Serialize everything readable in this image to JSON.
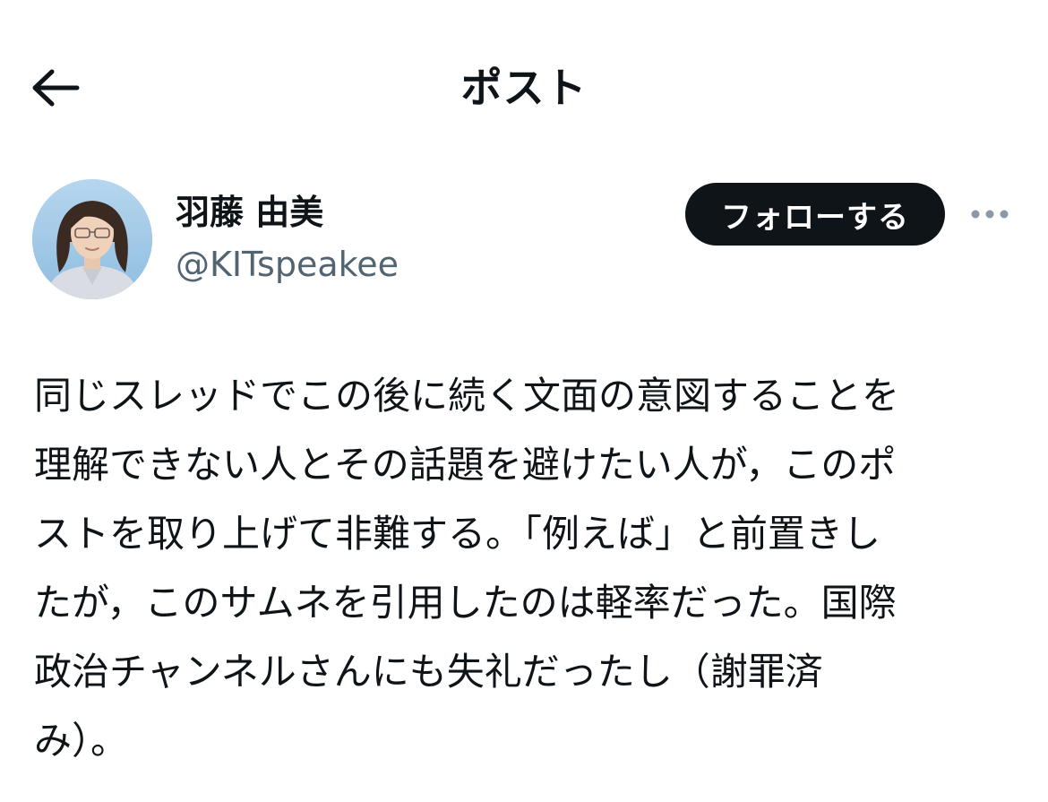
{
  "header": {
    "title": "ポスト",
    "back_icon": "arrow-left-icon"
  },
  "author": {
    "display_name": "羽藤 由美",
    "handle": "@KITspeakee",
    "avatar_icon": "user-avatar",
    "follow_label": "フォローする",
    "more_icon": "more-horizontal-icon"
  },
  "post": {
    "text": "同じスレッドでこの後に続く文面の意図することを\n理解できない人とその話題を避けたい人が，このポ\nストを取り上げて非難する。「例えば」と前置きし\nたが，このサムネを引用したのは軽率だった。国際\n政治チャンネルさんにも失礼だったし（謝罪済\nみ）。"
  },
  "colors": {
    "text_primary": "#0f1419",
    "text_secondary": "#536471",
    "follow_button_bg": "#0f1419",
    "follow_button_text": "#ffffff",
    "more_icon": "#8b98a5"
  }
}
